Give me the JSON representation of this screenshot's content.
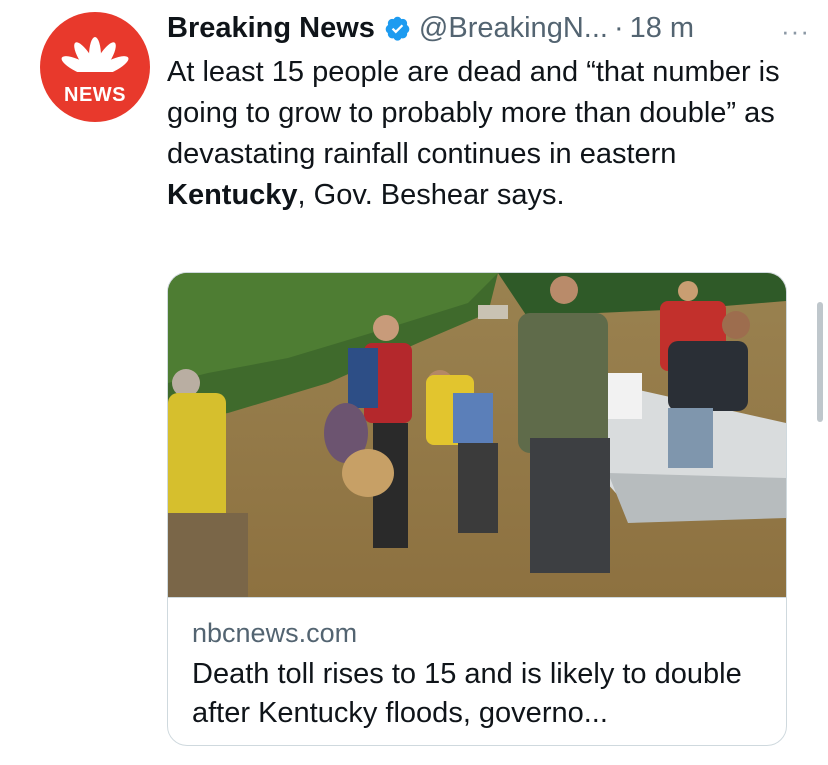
{
  "tweet": {
    "avatar_label": "NEWS",
    "display_name": "Breaking News",
    "handle": "@BreakingN...",
    "separator": "·",
    "time": "18 m",
    "more_glyph": "···",
    "text_before": "At least 15 people are dead and “that number is going to grow to probably more than double” as devastating rainfall continues in eastern ",
    "text_bold": "Kentucky",
    "text_after": ", Gov. Beshear says."
  },
  "card": {
    "domain": "nbcnews.com",
    "title": "Death toll rises to 15 and is likely to double after Kentucky floods, governo..."
  },
  "icons": {
    "avatar": "nbc-peacock-logo",
    "verified": "verified-badge-icon",
    "more": "more-options-icon"
  },
  "colors": {
    "avatar_bg": "#e8392c",
    "verified": "#1d9bf0",
    "secondary_text": "#536471",
    "border": "#cfd9de"
  }
}
